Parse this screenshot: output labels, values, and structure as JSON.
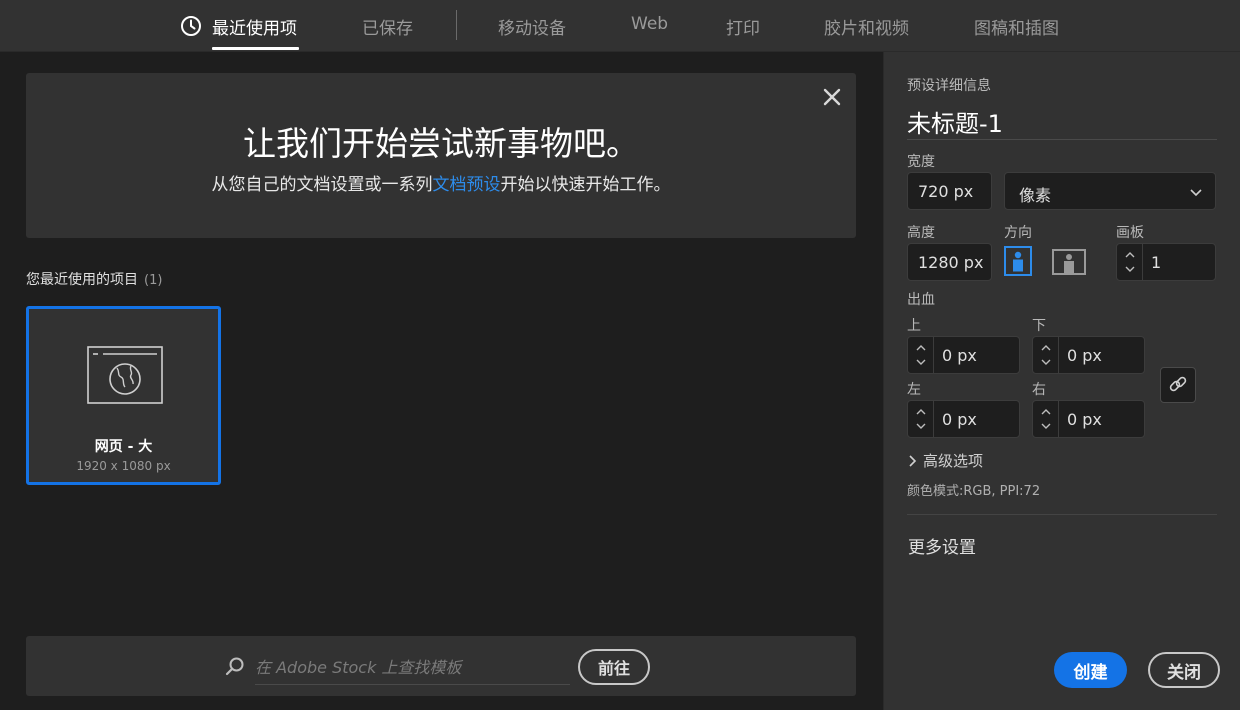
{
  "tabs": [
    {
      "label": "最近使用项",
      "active": true
    },
    {
      "label": "已保存"
    },
    {
      "label": "移动设备"
    },
    {
      "label": "Web"
    },
    {
      "label": "打印"
    },
    {
      "label": "胶片和视频"
    },
    {
      "label": "图稿和插图"
    }
  ],
  "banner": {
    "title": "让我们开始尝试新事物吧。",
    "sub_before": "从您自己的文档设置或一系列",
    "sub_link": "文档预设",
    "sub_after": "开始以快速开始工作。"
  },
  "recent": {
    "heading": "您最近使用的项目",
    "count": "(1)",
    "items": [
      {
        "name": "网页 - 大",
        "size": "1920 x 1080 px"
      }
    ]
  },
  "stock": {
    "placeholder": "在 Adobe Stock 上查找模板",
    "go_label": "前往"
  },
  "preset": {
    "heading": "预设详细信息",
    "title": "未标题-1",
    "width_label": "宽度",
    "width_value": "720 px",
    "unit_value": "像素",
    "height_label": "高度",
    "height_value": "1280 px",
    "orientation_label": "方向",
    "artboard_label": "画板",
    "artboard_value": "1",
    "bleed_label": "出血",
    "top_label": "上",
    "top_value": "0 px",
    "bottom_label": "下",
    "bottom_value": "0 px",
    "left_label": "左",
    "left_value": "0 px",
    "right_label": "右",
    "right_value": "0 px",
    "advanced_label": "高级选项",
    "color_mode": "颜色模式:RGB, PPI:72",
    "more_settings": "更多设置",
    "create_label": "创建",
    "close_label": "关闭"
  },
  "colors": {
    "accent": "#1473e6",
    "link": "#2d8ceb",
    "background": "#1e1e1e",
    "panel": "#323232"
  }
}
